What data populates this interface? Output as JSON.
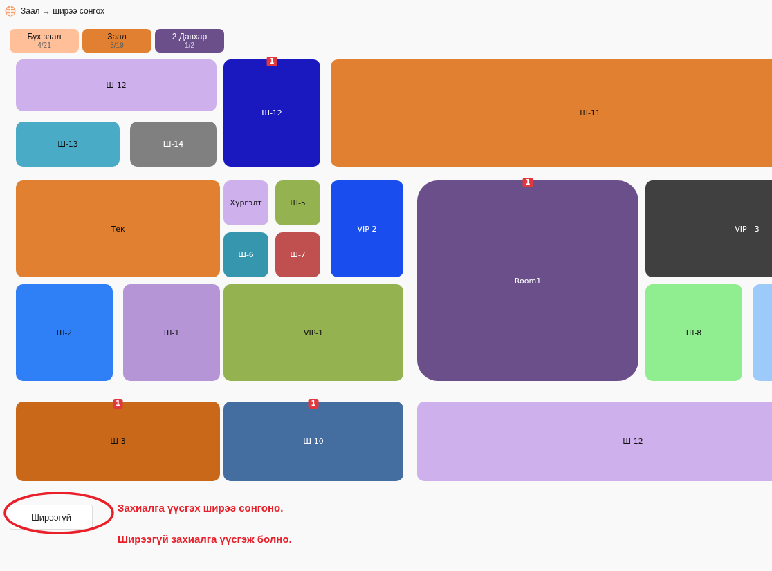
{
  "window": {
    "title": "Заал → ширээ сонгох"
  },
  "tabs": [
    {
      "label": "Бүх заал",
      "count": "4/21",
      "color": "#ffbf99",
      "light_label": false
    },
    {
      "label": "Заал",
      "count": "3/19",
      "color": "#e08030",
      "light_label": false
    },
    {
      "label": "2 Давхар",
      "count": "1/2",
      "color": "#6a4f8a",
      "light_label": true
    }
  ],
  "tables": [
    {
      "label": "Ш-12",
      "color": "#cdb0ec",
      "light_label": false
    },
    {
      "label": "Ш-12",
      "color": "#1a19bf",
      "light_label": true,
      "badge": "1"
    },
    {
      "label": "Ш-11",
      "color": "#e08030",
      "light_label": false
    },
    {
      "label": "Ш-13",
      "color": "#4aabc6",
      "light_label": false
    },
    {
      "label": "Ш-14",
      "color": "#808080",
      "light_label": true
    },
    {
      "label": "Тек",
      "color": "#e08030",
      "light_label": false
    },
    {
      "label": "Хүргэлт",
      "color": "#cdb0ec",
      "light_label": false
    },
    {
      "label": "Ш-5",
      "color": "#94b24f",
      "light_label": false
    },
    {
      "label": "Ш-6",
      "color": "#3596ae",
      "light_label": true
    },
    {
      "label": "Ш-7",
      "color": "#c05050",
      "light_label": true
    },
    {
      "label": "VIP-2",
      "color": "#194ded",
      "light_label": true
    },
    {
      "label": "Room1",
      "color": "#6a4f8a",
      "light_label": true,
      "badge": "1"
    },
    {
      "label": "VIP - 3",
      "color": "#404040",
      "light_label": true
    },
    {
      "label": "Ш-2",
      "color": "#2f80f7",
      "light_label": false
    },
    {
      "label": "Ш-1",
      "color": "#b595d5",
      "light_label": false
    },
    {
      "label": "VIP-1",
      "color": "#94b24f",
      "light_label": false
    },
    {
      "label": "Ш-8",
      "color": "#90ee90",
      "light_label": false
    },
    {
      "color": "#9ccbfb"
    },
    {
      "label": "Ш-3",
      "color": "#c96818",
      "light_label": false,
      "badge": "1"
    },
    {
      "label": "Ш-10",
      "color": "#446ea0",
      "light_label": true,
      "badge": "1"
    },
    {
      "label": "Ш-12",
      "color": "#cdb0ec",
      "light_label": false
    }
  ],
  "no_table_button": {
    "label": "Ширээгүй"
  },
  "annotations": [
    "Захиалга үүсгэх ширээ сонгоно.",
    "Ширээгүй захиалга үүсгэж болно."
  ]
}
